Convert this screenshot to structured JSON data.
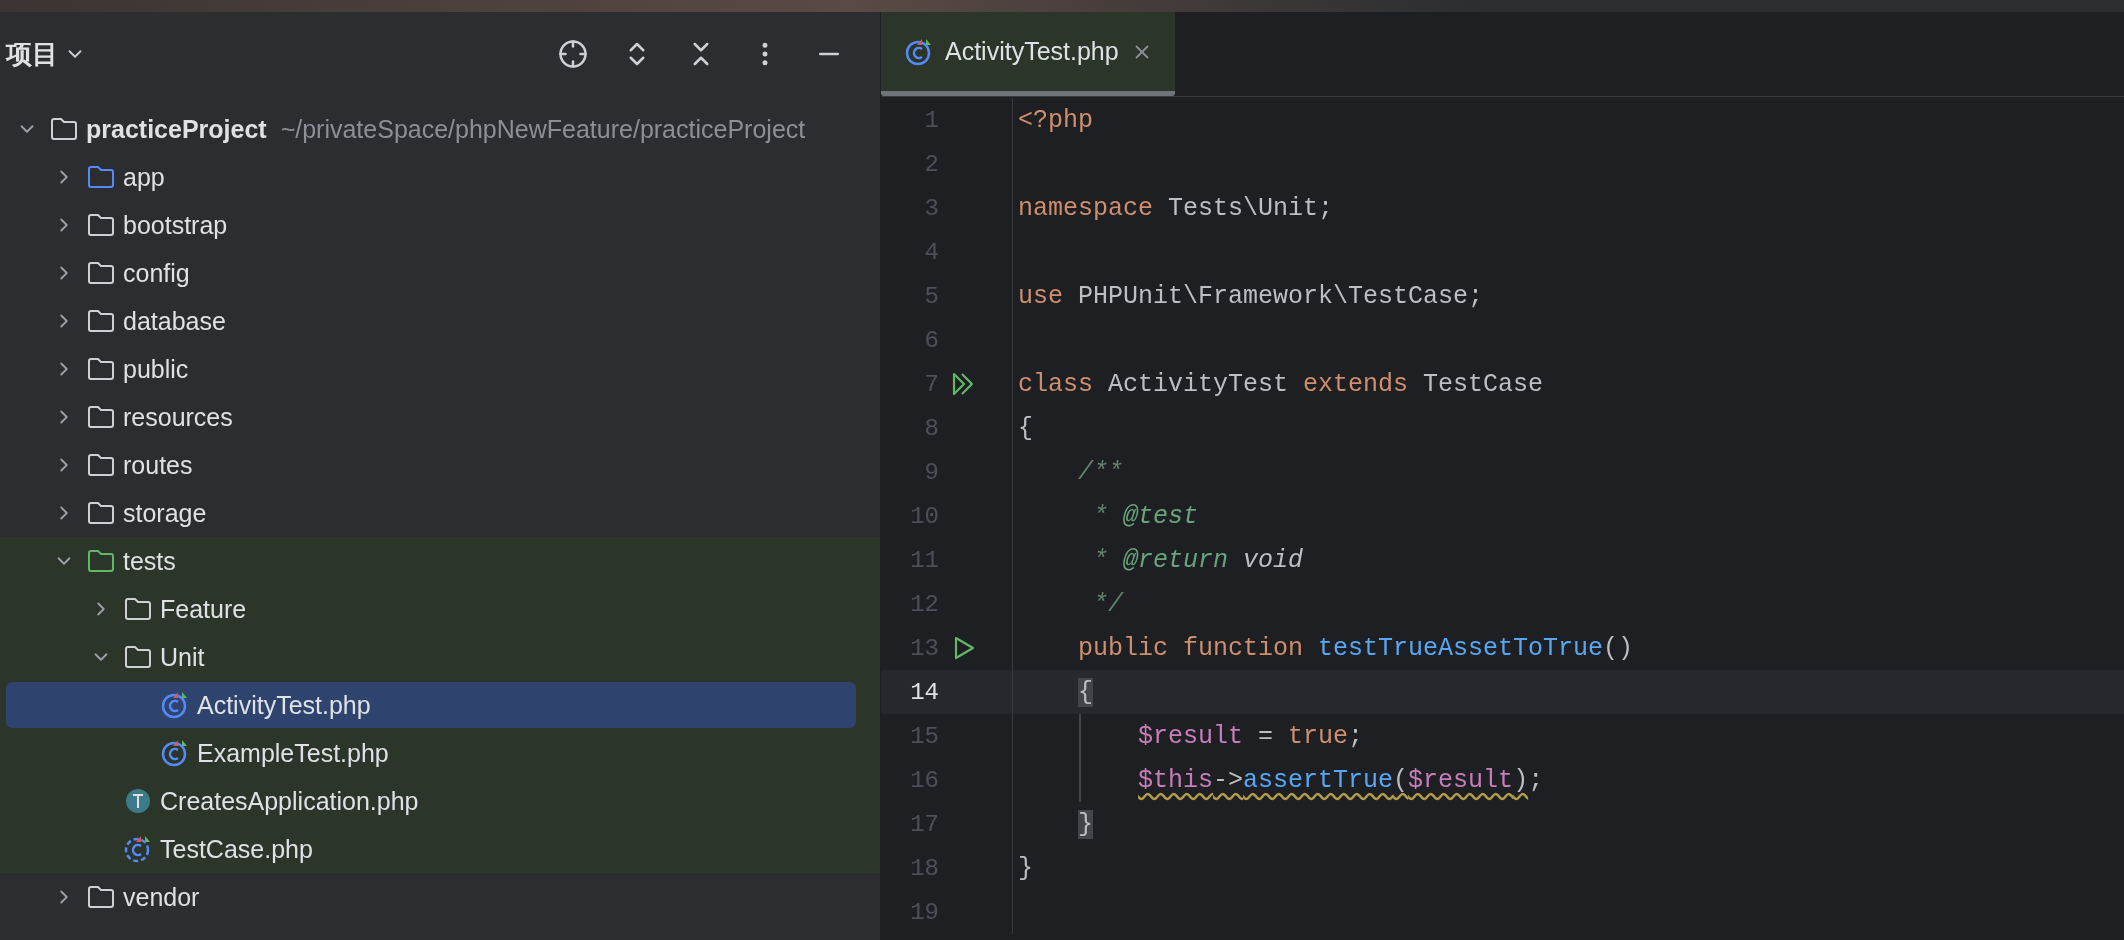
{
  "project_panel": {
    "title": "项目"
  },
  "tree": [
    {
      "kind": "folder",
      "name": "practiceProject",
      "hint": "~/privateSpace/phpNewFeature/practiceProject",
      "expanded": true,
      "selected": false,
      "children": [
        {
          "kind": "source-folder",
          "name": "app",
          "expanded": false,
          "selected": false
        },
        {
          "kind": "folder",
          "name": "bootstrap",
          "expanded": false,
          "selected": false
        },
        {
          "kind": "folder",
          "name": "config",
          "expanded": false,
          "selected": false
        },
        {
          "kind": "folder",
          "name": "database",
          "expanded": false,
          "selected": false
        },
        {
          "kind": "folder",
          "name": "public",
          "expanded": false,
          "selected": false
        },
        {
          "kind": "folder",
          "name": "resources",
          "expanded": false,
          "selected": false
        },
        {
          "kind": "folder",
          "name": "routes",
          "expanded": false,
          "selected": false
        },
        {
          "kind": "folder",
          "name": "storage",
          "expanded": false,
          "selected": false
        },
        {
          "kind": "test-folder",
          "name": "tests",
          "expanded": true,
          "selected": false,
          "children": [
            {
              "kind": "folder",
              "name": "Feature",
              "expanded": false,
              "selected": false
            },
            {
              "kind": "folder",
              "name": "Unit",
              "expanded": true,
              "selected": false,
              "children": [
                {
                  "kind": "test-class",
                  "name": "ActivityTest.php",
                  "selected": true
                },
                {
                  "kind": "test-class",
                  "name": "ExampleTest.php",
                  "selected": false
                }
              ]
            },
            {
              "kind": "trait",
              "name": "CreatesApplication.php",
              "selected": false
            },
            {
              "kind": "abstract-test-class",
              "name": "TestCase.php",
              "selected": false
            }
          ]
        },
        {
          "kind": "folder",
          "name": "vendor",
          "expanded": false,
          "selected": false
        }
      ]
    }
  ],
  "editor": {
    "tabs": [
      {
        "label": "ActivityTest.php",
        "selected": true
      }
    ],
    "lines": [
      {
        "number": "1",
        "tokens": [
          {
            "kind": "keyword",
            "text": "<?php"
          }
        ]
      },
      {
        "number": "2"
      },
      {
        "number": "3",
        "tokens": [
          {
            "kind": "keyword",
            "text": "namespace "
          },
          {
            "kind": "plain",
            "text": "Tests\\Unit;"
          }
        ]
      },
      {
        "number": "4"
      },
      {
        "number": "5",
        "tokens": [
          {
            "kind": "keyword",
            "text": "use "
          },
          {
            "kind": "plain",
            "text": "PHPUnit\\Framework\\TestCase;"
          }
        ]
      },
      {
        "number": "6"
      },
      {
        "number": "7",
        "gutter": {
          "kind": "run-all"
        },
        "tokens": [
          {
            "kind": "keyword",
            "text": "class "
          },
          {
            "kind": "plain",
            "text": "ActivityTest "
          },
          {
            "kind": "keyword",
            "text": "extends "
          },
          {
            "kind": "plain",
            "text": "TestCase"
          }
        ]
      },
      {
        "number": "8",
        "tokens": [
          {
            "kind": "plain",
            "text": "{"
          }
        ]
      },
      {
        "number": "9",
        "tokens": [
          {
            "kind": "comment",
            "text": "    /**"
          }
        ]
      },
      {
        "number": "10",
        "tokens": [
          {
            "kind": "comment",
            "text": "     * "
          },
          {
            "kind": "doctag",
            "text": "@test"
          }
        ]
      },
      {
        "number": "11",
        "tokens": [
          {
            "kind": "comment",
            "text": "     * "
          },
          {
            "kind": "doctag",
            "text": "@return "
          },
          {
            "kind": "docvalue",
            "text": "void"
          }
        ]
      },
      {
        "number": "12",
        "tokens": [
          {
            "kind": "comment",
            "text": "     */"
          }
        ]
      },
      {
        "number": "13",
        "gutter": {
          "kind": "run"
        },
        "tokens": [
          {
            "kind": "keyword",
            "text": "    public function "
          },
          {
            "kind": "function",
            "text": "testTrueAssetToTrue"
          },
          {
            "kind": "plain",
            "text": "()"
          }
        ]
      },
      {
        "number": "14",
        "current": true,
        "tokens": [
          {
            "kind": "plain",
            "text": "    {",
            "matched": true
          }
        ]
      },
      {
        "number": "15",
        "guide": true,
        "tokens": [
          {
            "kind": "variable",
            "text": "        $result"
          },
          {
            "kind": "plain",
            "text": " = "
          },
          {
            "kind": "keyword",
            "text": "true"
          },
          {
            "kind": "plain",
            "text": ";"
          }
        ]
      },
      {
        "number": "16",
        "guide": true,
        "tokens": [
          {
            "kind": "variable",
            "text": "        $this",
            "warning": true
          },
          {
            "kind": "plain",
            "text": "->",
            "warning": true
          },
          {
            "kind": "function",
            "text": "assertTrue",
            "warning": true
          },
          {
            "kind": "plain",
            "text": "(",
            "warning": true
          },
          {
            "kind": "variable",
            "text": "$result",
            "warning": true
          },
          {
            "kind": "plain",
            "text": ")",
            "warning": true
          },
          {
            "kind": "plain",
            "text": ";"
          }
        ]
      },
      {
        "number": "17",
        "tokens": [
          {
            "kind": "plain",
            "text": "    }",
            "matched": true
          }
        ]
      },
      {
        "number": "18",
        "tokens": [
          {
            "kind": "plain",
            "text": "}"
          }
        ]
      },
      {
        "number": "19"
      }
    ]
  }
}
